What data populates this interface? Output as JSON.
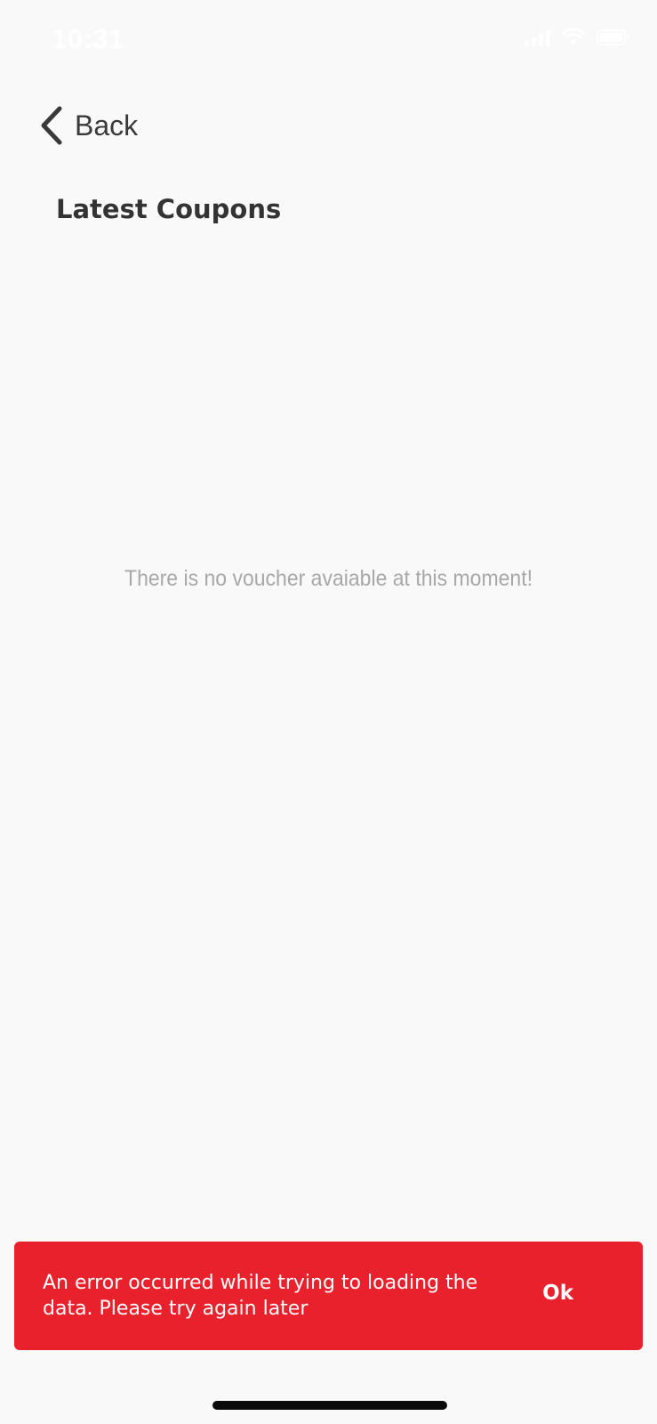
{
  "status_bar": {
    "time": "10:31",
    "icons": [
      "signal-icon",
      "wifi-icon",
      "battery-icon"
    ]
  },
  "nav": {
    "back_label": "Back",
    "back_icon": "chevron-left-icon"
  },
  "page": {
    "title": "Latest Coupons",
    "empty_message": "There is no voucher avaiable at this moment!"
  },
  "snackbar": {
    "message": "An error occurred while trying to loading the data. Please try again later",
    "action_label": "Ok",
    "background_color": "#e8212d"
  },
  "colors": {
    "background": "#f9f9f9",
    "title": "#333333",
    "muted_text": "#a8a8a8",
    "error": "#e8212d"
  }
}
